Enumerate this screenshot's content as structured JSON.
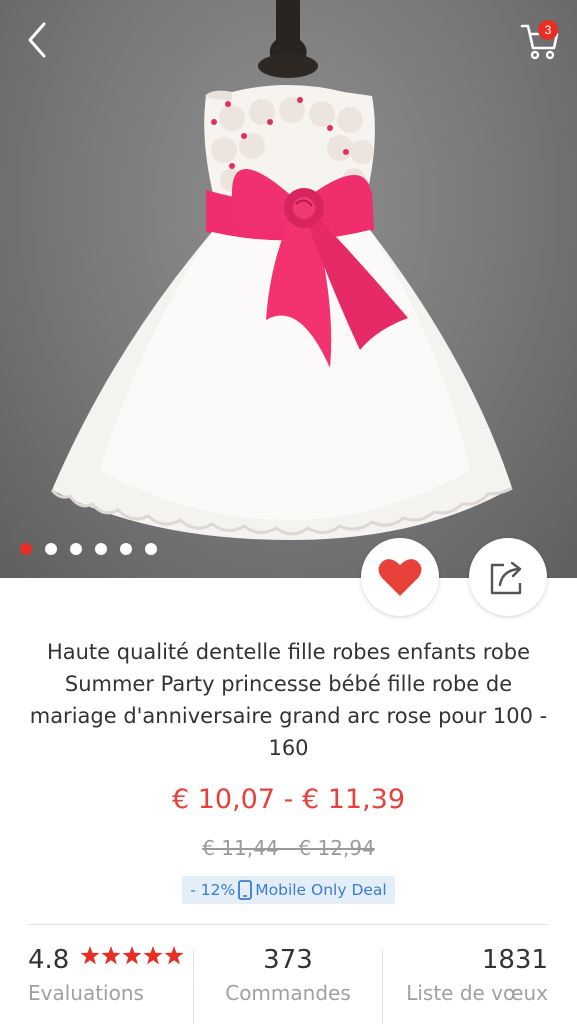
{
  "header": {
    "cart_count": "3",
    "back_icon": "back-arrow-icon",
    "cart_icon": "shopping-cart-icon"
  },
  "gallery": {
    "image_count": 6,
    "active_index": 0,
    "active_dot_color": "#e62e24"
  },
  "actions": {
    "wishlist_icon": "heart-icon",
    "share_icon": "share-icon",
    "heart_color": "#e8413b"
  },
  "product": {
    "title": "Haute qualité dentelle fille robes enfants robe Summer Party princesse bébé fille robe de mariage d'anniversaire grand arc rose pour 100 - 160",
    "price": "€ 10,07 - € 11,39",
    "original_price": "€ 11,44 - € 12,94",
    "deal_discount": "- 12%",
    "deal_label": "Mobile Only Deal",
    "price_color": "#e8413b",
    "deal_color": "#3c7cd0"
  },
  "stats": {
    "rating": "4.8",
    "rating_stars": 5,
    "rating_label": "Evaluations",
    "orders": "373",
    "orders_label": "Commandes",
    "wishlist": "1831",
    "wishlist_label": "Liste de vœux"
  }
}
